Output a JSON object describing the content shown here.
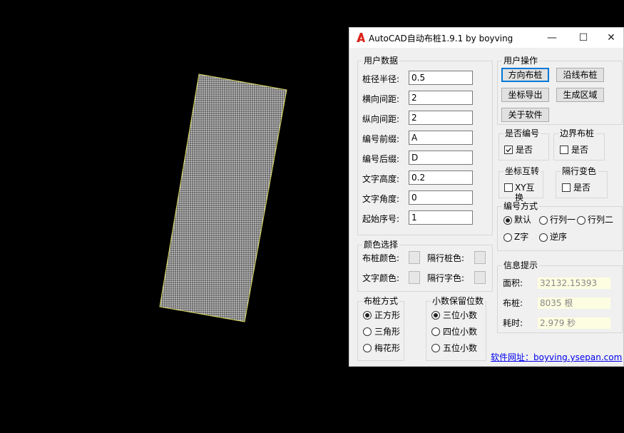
{
  "window": {
    "title": "AutoCAD自动布桩1.9.1 by boyving",
    "minimize_glyph": "—",
    "maximize_glyph": "☐",
    "close_glyph": "✕"
  },
  "user_data": {
    "title": "用户数据",
    "fields": [
      {
        "label": "桩径半径:",
        "value": "0.5"
      },
      {
        "label": "横向间距:",
        "value": "2"
      },
      {
        "label": "纵向间距:",
        "value": "2"
      },
      {
        "label": "编号前缀:",
        "value": "A"
      },
      {
        "label": "编号后缀:",
        "value": "D"
      },
      {
        "label": "文字高度:",
        "value": "0.2"
      },
      {
        "label": "文字角度:",
        "value": "0"
      },
      {
        "label": "起始序号:",
        "value": "1"
      }
    ]
  },
  "color_select": {
    "title": "颜色选择",
    "pile_color": "布桩颜色:",
    "alt_pile_color": "隔行桩色:",
    "text_color": "文字颜色:",
    "alt_text_color": "隔行字色:"
  },
  "layout_mode": {
    "title": "布桩方式",
    "options": [
      "正方形",
      "三角形",
      "梅花形"
    ],
    "selected": 0
  },
  "decimals": {
    "title": "小数保留位数",
    "options": [
      "三位小数",
      "四位小数",
      "五位小数"
    ],
    "selected": 0
  },
  "user_ops": {
    "title": "用户操作",
    "buttons": [
      "方向布桩",
      "沿线布桩",
      "坐标导出",
      "生成区域",
      "关于软件"
    ]
  },
  "numbering": {
    "title": "是否编号",
    "label": "是否",
    "checked": true
  },
  "border_pile": {
    "title": "边界布桩",
    "label": "是否",
    "checked": false
  },
  "coord_swap": {
    "title": "坐标互转",
    "label": "XY互换",
    "checked": false
  },
  "row_color": {
    "title": "隔行变色",
    "label": "是否",
    "checked": false
  },
  "numbering_mode": {
    "title": "编号方式",
    "options": [
      "默认",
      "行列一",
      "行列二",
      "Z字",
      "逆序"
    ],
    "selected": 0
  },
  "info": {
    "title": "信息提示",
    "rows": [
      {
        "label": "面积:",
        "value": "32132.15393"
      },
      {
        "label": "布桩:",
        "value": "8035 根"
      },
      {
        "label": "耗时:",
        "value": "2.979 秒"
      }
    ]
  },
  "footer": {
    "link_text": "软件网址：boyving.ysepan.com"
  },
  "colors": {
    "background": "#000000",
    "pile_fill": "#9a9a9a",
    "pile_outline": "#d8d860",
    "window_bg": "#f0f0f0",
    "accent": "#0078d7",
    "logo_red": "#d9261c"
  },
  "drawing": {
    "shape": "pile-grid-region",
    "pile_count_shown": "8035"
  }
}
